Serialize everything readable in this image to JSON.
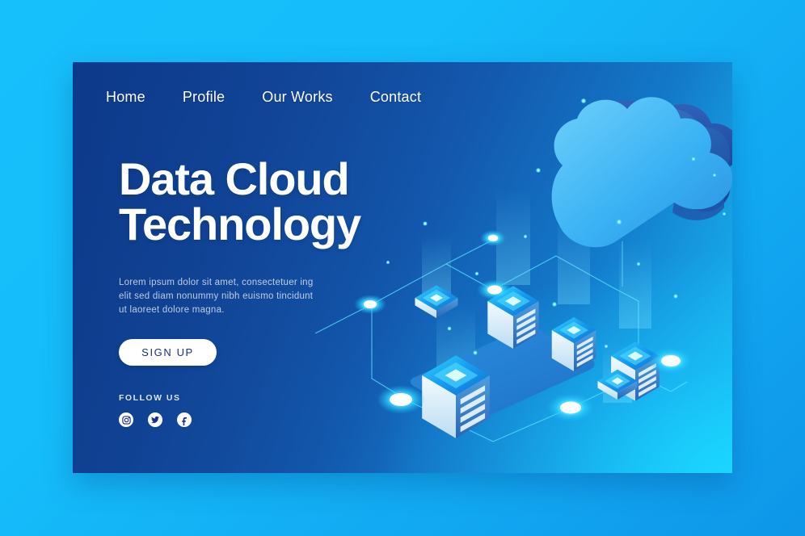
{
  "page": {
    "background_color": "#16c0fb",
    "card_color_start": "#0f3f96",
    "card_color_end": "#1ccdfb"
  },
  "nav": {
    "items": [
      {
        "label": "Home"
      },
      {
        "label": "Profile"
      },
      {
        "label": "Our Works"
      },
      {
        "label": "Contact"
      }
    ]
  },
  "hero": {
    "title_line1": "Data Cloud",
    "title_line2": "Technology",
    "description": "Lorem ipsum dolor sit amet, consectetuer ing elit sed diam nonummy nibh euismo tincidunt ut laoreet dolore magna.",
    "cta_label": "SIGN UP",
    "cta_background": "#ffffff",
    "cta_text_color": "#16308a"
  },
  "follow": {
    "label": "FOLLOW US",
    "icons": [
      {
        "name": "instagram-icon"
      },
      {
        "name": "twitter-icon"
      },
      {
        "name": "facebook-icon"
      }
    ]
  },
  "illustration": {
    "name": "isometric-cloud-network",
    "accent_glow": "#25e6ff",
    "cloud_top_color": "#3fb7f5",
    "cloud_side_color": "#1b4fa8",
    "server_top_color": "#1e9cf0",
    "server_face_light": "#dff0fb",
    "server_face_dark": "#2b6fc4"
  }
}
